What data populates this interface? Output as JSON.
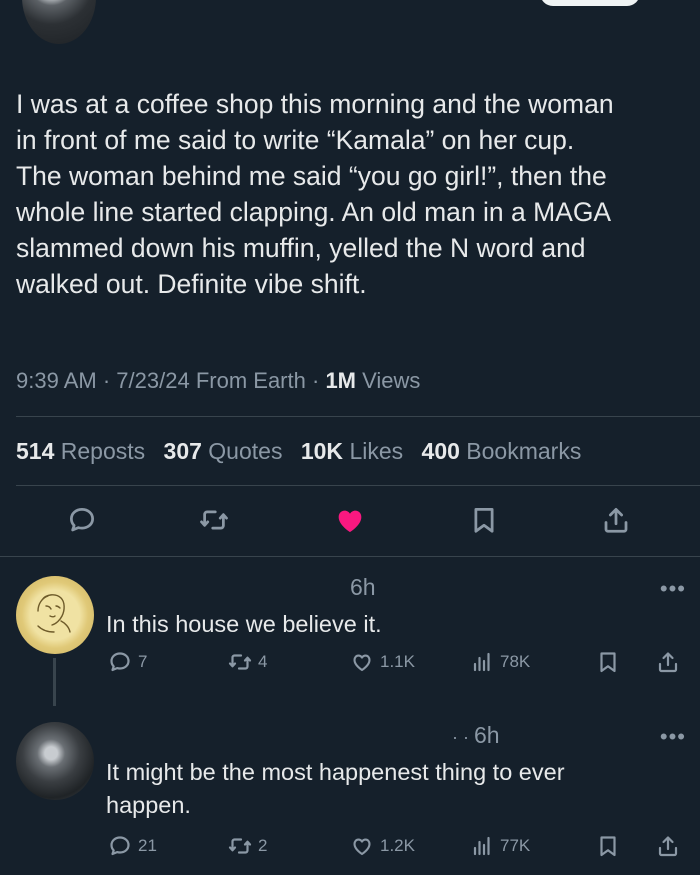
{
  "tweet": {
    "text": "I was at a coffee shop this morning and the woman\nin front of me said to write “Kamala” on her cup.\nThe woman behind me said “you go girl!”, then the\nwhole line started clapping. An old man in a MAGA\nslammed down his muffin, yelled the N word and\nwalked out. Definite vibe shift.",
    "time": "9:39 AM",
    "date": "7/23/24",
    "source": "From Earth",
    "views_count": "1M",
    "views_label": "Views"
  },
  "stats": {
    "reposts": {
      "count": "514",
      "label": "Reposts"
    },
    "quotes": {
      "count": "307",
      "label": "Quotes"
    },
    "likes": {
      "count": "10K",
      "label": "Likes"
    },
    "bookmarks": {
      "count": "400",
      "label": "Bookmarks"
    }
  },
  "actions": {
    "icons": [
      "reply-icon",
      "repost-icon",
      "like-icon",
      "bookmark-icon",
      "share-icon"
    ],
    "like_color": "#f91880"
  },
  "replies": [
    {
      "time": "6h",
      "text": "In this house we believe it.",
      "reply_count": "7",
      "repost_count": "4",
      "like_count": "1.1K",
      "view_count": "78K"
    },
    {
      "time": "6h",
      "text": "It might be the most happenest thing to ever happen.",
      "reply_count": "21",
      "repost_count": "2",
      "like_count": "1.2K",
      "view_count": "77K"
    }
  ],
  "colors": {
    "background": "#15202b",
    "text": "#e7e9ea",
    "secondary_text": "#8b98a5",
    "divider": "#38444d"
  }
}
